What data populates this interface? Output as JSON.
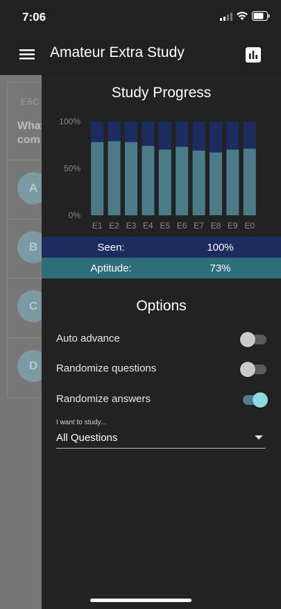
{
  "status_bar": {
    "time": "7:06"
  },
  "app_bar": {
    "title": "Amateur Extra Study"
  },
  "background": {
    "code": "E6C",
    "question_lines": [
      "What",
      "com"
    ],
    "answer_letters": [
      "A",
      "B",
      "C",
      "D"
    ]
  },
  "drawer": {
    "title": "Study Progress",
    "stats": {
      "seen_label": "Seen:",
      "seen_value": "100%",
      "aptitude_label": "Aptitude:",
      "aptitude_value": "73%"
    },
    "options_title": "Options",
    "options": [
      {
        "label": "Auto advance",
        "enabled": false
      },
      {
        "label": "Randomize questions",
        "enabled": false
      },
      {
        "label": "Randomize answers",
        "enabled": true
      }
    ],
    "study_select": {
      "caption": "I want to study...",
      "value": "All Questions"
    }
  },
  "colors": {
    "seen": "#1d2c5e",
    "aptitude": "#4b7b88",
    "accent": "#8ed6e4"
  },
  "chart_data": {
    "type": "bar",
    "categories": [
      "E1",
      "E2",
      "E3",
      "E4",
      "E5",
      "E6",
      "E7",
      "E8",
      "E9",
      "E0"
    ],
    "series": [
      {
        "name": "Seen",
        "values": [
          100,
          100,
          100,
          100,
          100,
          100,
          100,
          100,
          100,
          100
        ]
      },
      {
        "name": "Aptitude",
        "values": [
          78,
          79,
          78,
          74,
          70,
          73,
          69,
          67,
          70,
          71
        ]
      }
    ],
    "y_tick_labels": [
      "100%",
      "50%",
      "0%"
    ],
    "ylim": [
      0,
      100
    ],
    "grid": false
  }
}
